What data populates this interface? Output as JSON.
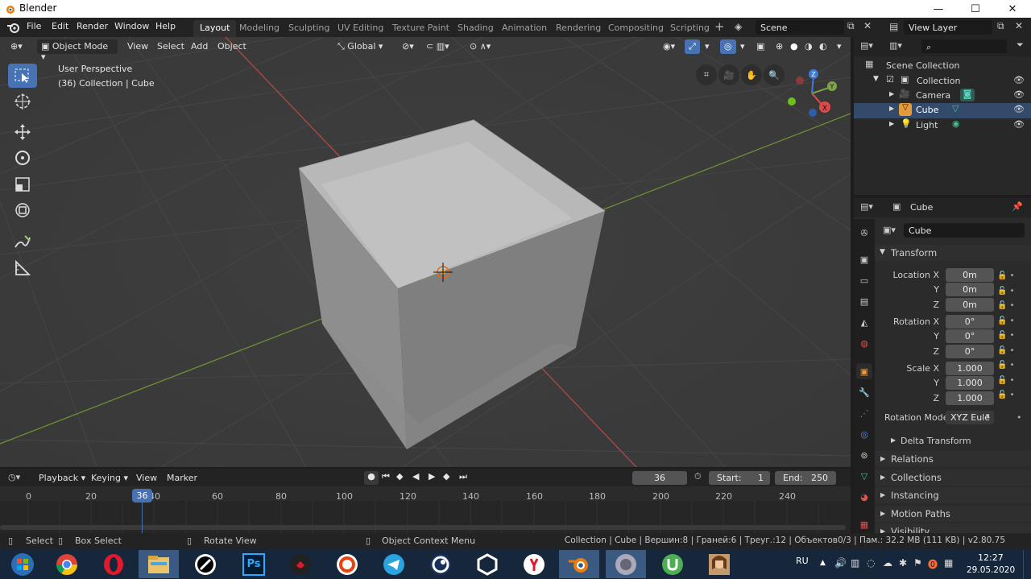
{
  "window": {
    "title": "Blender"
  },
  "menus": [
    "File",
    "Edit",
    "Render",
    "Window",
    "Help"
  ],
  "workspaces": [
    "Layout",
    "Modeling",
    "Sculpting",
    "UV Editing",
    "Texture Paint",
    "Shading",
    "Animation",
    "Rendering",
    "Compositing",
    "Scripting"
  ],
  "scene": {
    "name": "Scene",
    "view_layer": "View Layer"
  },
  "viewport": {
    "mode": "Object Mode",
    "menus": [
      "View",
      "Select",
      "Add",
      "Object"
    ],
    "orientation": "Global",
    "info_line1": "User Perspective",
    "info_line2": "(36) Collection | Cube",
    "gizmo": {
      "x": "X",
      "y": "Y",
      "z": "Z"
    }
  },
  "outliner": {
    "root": "Scene Collection",
    "collection": "Collection",
    "items": [
      "Camera",
      "Cube",
      "Light"
    ]
  },
  "properties": {
    "object_name": "Cube",
    "datablock": "Cube",
    "transform_title": "Transform",
    "loc_label": "Location X",
    "rot_label": "Rotation X",
    "scale_label": "Scale X",
    "y_label": "Y",
    "z_label": "Z",
    "location": [
      "0m",
      "0m",
      "0m"
    ],
    "rotation": [
      "0°",
      "0°",
      "0°"
    ],
    "scale": [
      "1.000",
      "1.000",
      "1.000"
    ],
    "rotation_mode_label": "Rotation Mode",
    "rotation_mode": "XYZ Eule",
    "sections": [
      "Delta Transform",
      "Relations",
      "Collections",
      "Instancing",
      "Motion Paths",
      "Visibility"
    ]
  },
  "timeline": {
    "menus": [
      "Playback",
      "Keying",
      "View",
      "Marker"
    ],
    "current_frame": "36",
    "start_label": "Start:",
    "start": "1",
    "end_label": "End:",
    "end": "250",
    "ticks": [
      "0",
      "20",
      "40",
      "60",
      "80",
      "100",
      "120",
      "140",
      "160",
      "180",
      "200",
      "220",
      "240"
    ]
  },
  "status": {
    "select": "Select",
    "box_select": "Box Select",
    "rotate_view": "Rotate View",
    "context_menu": "Object Context Menu",
    "stats": "Collection | Cube | Вершин:8 | Граней:6 | Треуг.:12 | Объектов0/3 | Пам.: 32.2 MB (111 KB) | v2.80.75"
  },
  "taskbar": {
    "lang": "RU",
    "time": "12:27",
    "date": "29.05.2020",
    "apps": [
      "chrome",
      "opera",
      "explorer",
      "inkscape",
      "photoshop",
      "app",
      "ubisoft",
      "telegram",
      "cinema4d",
      "unity",
      "yandex",
      "blender",
      "speaker",
      "utorrent",
      "avatar"
    ]
  },
  "colors": {
    "accent": "#4772b3",
    "x_axis": "#e04a4a",
    "y_axis": "#7ea34a",
    "z_axis": "#3f7ad4"
  }
}
